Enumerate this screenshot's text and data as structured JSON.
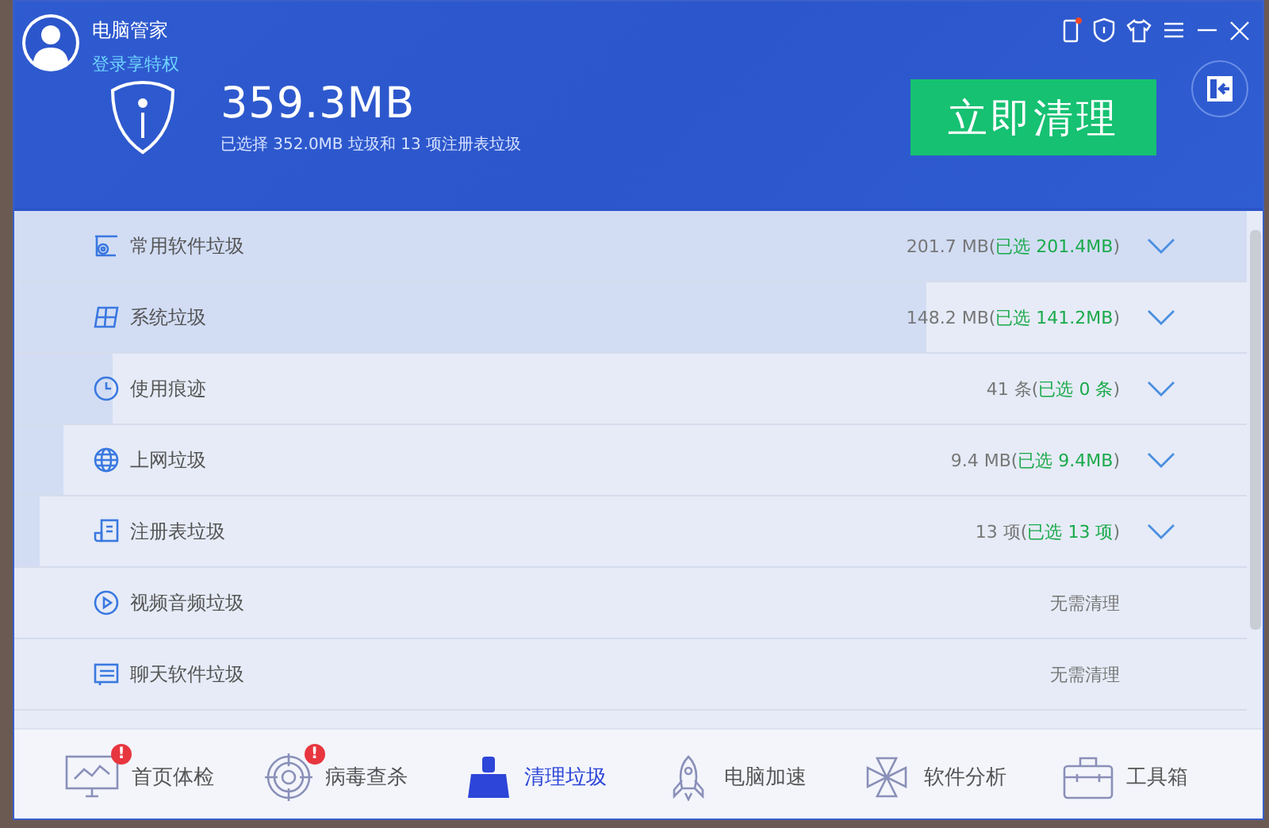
{
  "window": {
    "title": "电脑管家",
    "login_link": "登录享特权"
  },
  "summary": {
    "total": "359.3MB",
    "detail": "已选择 352.0MB 垃圾和 13 项注册表垃圾",
    "action": "立即清理"
  },
  "rows": [
    {
      "kind": "disc",
      "label": "常用软件垃圾",
      "expandable": true,
      "level": 1,
      "reading": [
        {
          "kind": "total",
          "text": "201.7 MB("
        },
        {
          "kind": "picked",
          "text": "已选 201.4MB"
        },
        {
          "kind": "total",
          "text": ")"
        }
      ]
    },
    {
      "kind": "windows",
      "label": "系统垃圾",
      "expandable": true,
      "level": 0.74,
      "reading": [
        {
          "kind": "total",
          "text": "148.2 MB("
        },
        {
          "kind": "picked",
          "text": "已选 141.2MB"
        },
        {
          "kind": "total",
          "text": ")"
        }
      ]
    },
    {
      "kind": "clock",
      "label": "使用痕迹",
      "expandable": true,
      "level": 0.08,
      "reading": [
        {
          "kind": "total",
          "text": "41 条("
        },
        {
          "kind": "picked",
          "text": "已选 0 条"
        },
        {
          "kind": "total",
          "text": ")"
        }
      ]
    },
    {
      "kind": "globe",
      "label": "上网垃圾",
      "expandable": true,
      "level": 0.04,
      "reading": [
        {
          "kind": "total",
          "text": "9.4 MB("
        },
        {
          "kind": "picked",
          "text": "已选 9.4MB"
        },
        {
          "kind": "total",
          "text": ")"
        }
      ]
    },
    {
      "kind": "registry",
      "label": "注册表垃圾",
      "expandable": true,
      "level": 0.02,
      "reading": [
        {
          "kind": "total",
          "text": "13 项("
        },
        {
          "kind": "picked",
          "text": "已选 13 项"
        },
        {
          "kind": "total",
          "text": ")"
        }
      ]
    },
    {
      "kind": "play",
      "label": "视频音频垃圾",
      "expandable": false,
      "reading": [
        {
          "kind": "total",
          "text": "无需清理"
        }
      ]
    },
    {
      "kind": "chat",
      "label": "聊天软件垃圾",
      "expandable": false,
      "reading": [
        {
          "kind": "total",
          "text": "无需清理"
        }
      ]
    }
  ],
  "nav": [
    {
      "kind": "monitor",
      "label": "首页体检",
      "badge": "!",
      "selected": false
    },
    {
      "kind": "target",
      "label": "病毒查杀",
      "badge": "!",
      "selected": false
    },
    {
      "kind": "broom",
      "label": "清理垃圾",
      "selected": true
    },
    {
      "kind": "rocket",
      "label": "电脑加速",
      "selected": false
    },
    {
      "kind": "clover",
      "label": "软件分析",
      "selected": false
    },
    {
      "kind": "toolbox",
      "label": "工具箱",
      "selected": false
    }
  ]
}
